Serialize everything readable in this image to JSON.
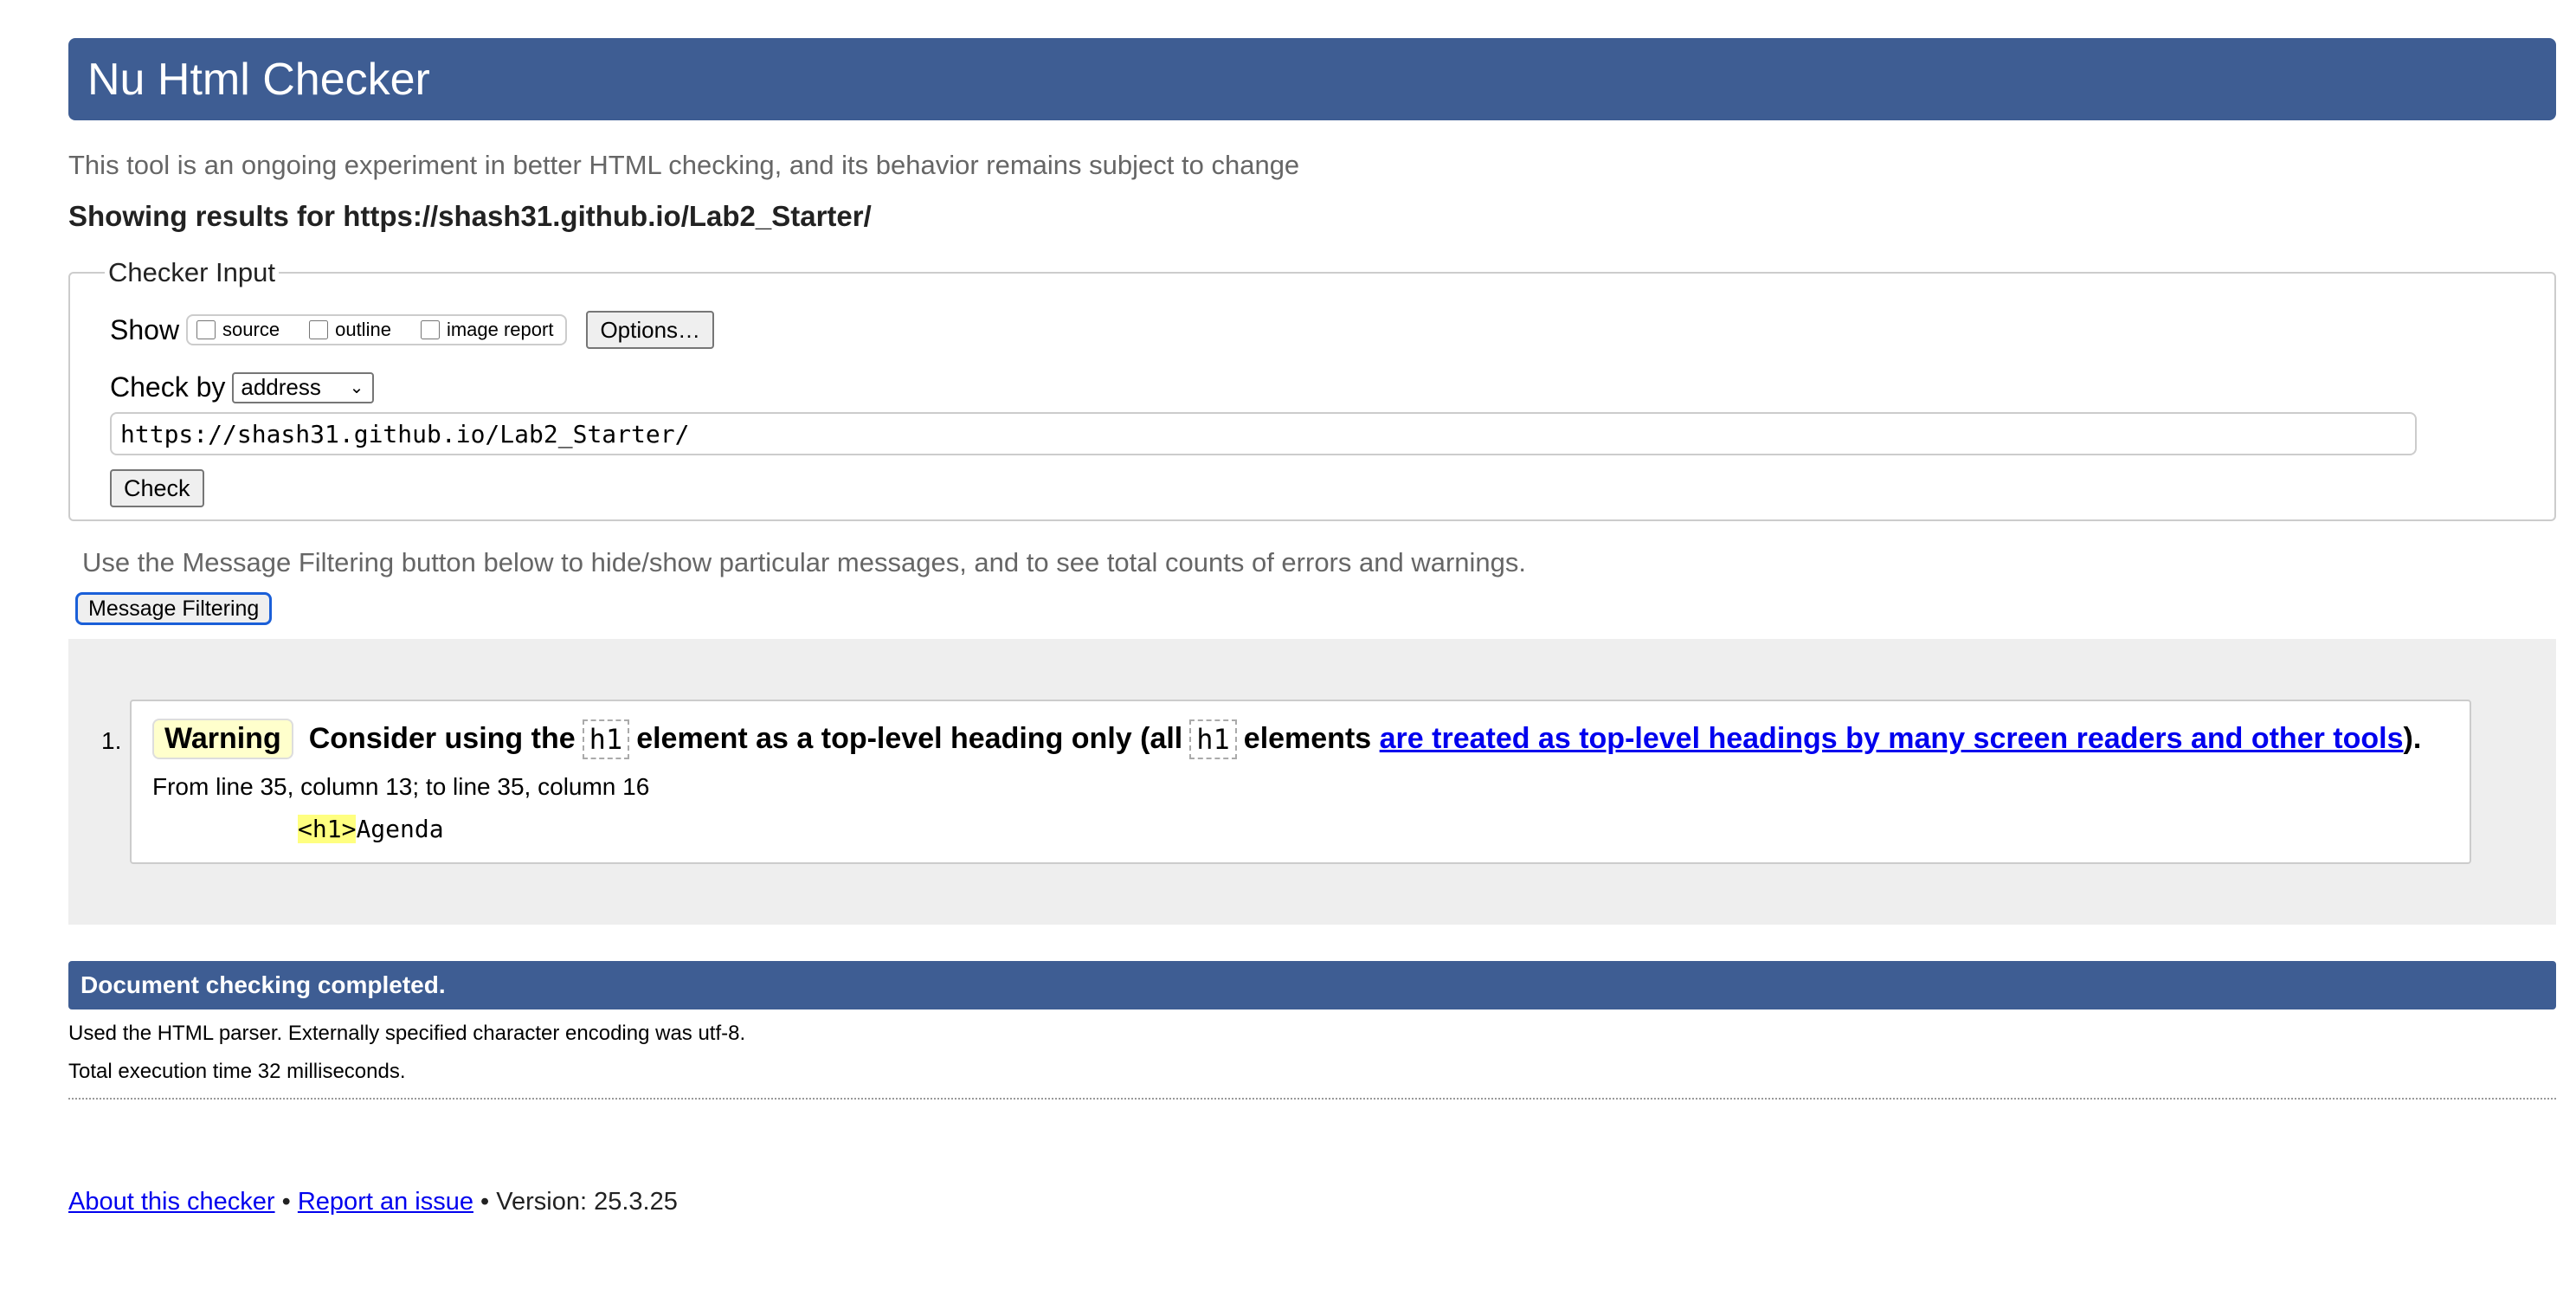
{
  "header": {
    "title": "Nu Html Checker"
  },
  "tagline": "This tool is an ongoing experiment in better HTML checking, and its behavior remains subject to change",
  "showing": "Showing results for https://shash31.github.io/Lab2_Starter/",
  "checker_input": {
    "legend": "Checker Input",
    "show_label": "Show",
    "show_options": {
      "source": "source",
      "outline": "outline",
      "image_report": "image report"
    },
    "options_button": "Options…",
    "check_by_label": "Check by",
    "check_by_value": "address",
    "url_value": "https://shash31.github.io/Lab2_Starter/",
    "check_button": "Check"
  },
  "filter": {
    "hint": "Use the Message Filtering button below to hide/show particular messages, and to see total counts of errors and warnings.",
    "button": "Message Filtering"
  },
  "messages": [
    {
      "number": "1.",
      "type": "Warning",
      "text_a": "Consider using the",
      "code_a": "h1",
      "text_b": "element as a top-level heading only (all",
      "code_b": "h1",
      "text_c": "elements",
      "link": "are treated as top-level headings by many screen readers and other tools",
      "text_d": ").",
      "location": "From line 35, column 13; to line 35, column 16",
      "extract_highlight": "<h1>",
      "extract_rest": "Agenda"
    }
  ],
  "completion": {
    "title": "Document checking completed.",
    "parser_note": "Used the HTML parser. Externally specified character encoding was utf-8.",
    "exec_time": "Total execution time 32 milliseconds."
  },
  "footer": {
    "about": "About this checker",
    "sep1": " • ",
    "report": "Report an issue",
    "version": " • Version: 25.3.25"
  },
  "colors": {
    "brand": "#3e5d93",
    "warning_bg": "#ffffcc",
    "link": "#0000ee"
  }
}
